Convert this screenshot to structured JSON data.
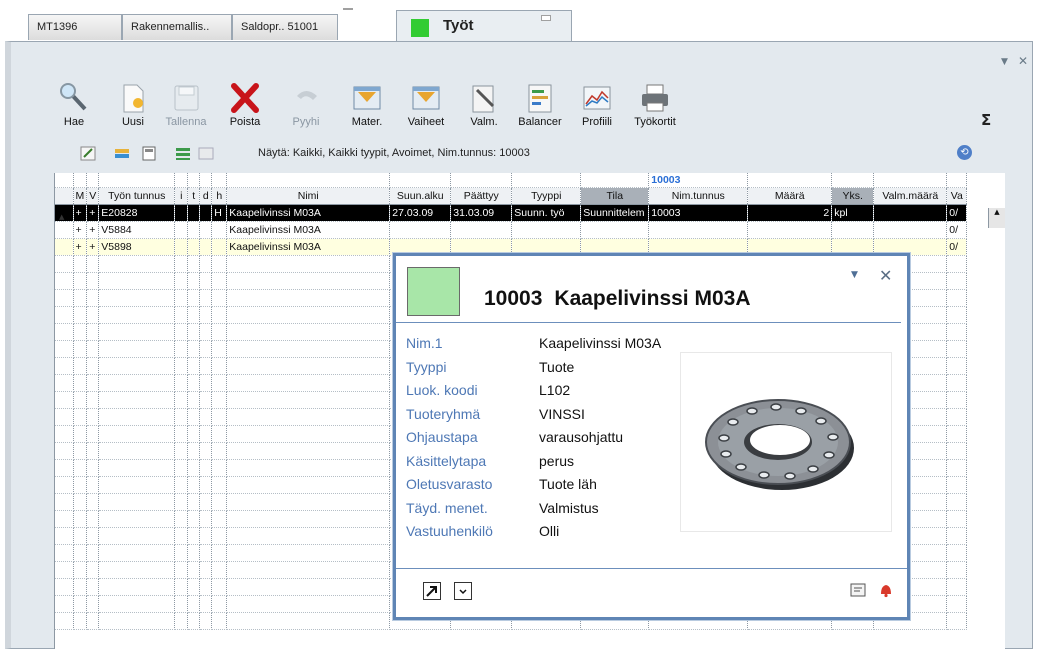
{
  "tabs": [
    {
      "label": "MT1396"
    },
    {
      "label": "Rakennemallis.."
    },
    {
      "label": "Saldopr.. 51001"
    },
    {
      "label": "Työt"
    }
  ],
  "toolbar": {
    "items": [
      {
        "label": "Hae",
        "icon": "search-icon",
        "enabled": true
      },
      {
        "label": "Uusi",
        "icon": "new-document-icon",
        "enabled": true
      },
      {
        "label": "Tallenna",
        "icon": "save-icon",
        "enabled": false
      },
      {
        "label": "Poista",
        "icon": "delete-icon",
        "enabled": true
      },
      {
        "label": "Pyyhi",
        "icon": "undo-icon",
        "enabled": false
      },
      {
        "label": "Mater.",
        "icon": "materials-icon",
        "enabled": true
      },
      {
        "label": "Vaiheet",
        "icon": "phases-icon",
        "enabled": true
      },
      {
        "label": "Valm.",
        "icon": "manufacture-icon",
        "enabled": true
      },
      {
        "label": "Balancer",
        "icon": "balancer-icon",
        "enabled": true
      },
      {
        "label": "Profiili",
        "icon": "profile-chart-icon",
        "enabled": true
      },
      {
        "label": "Työkortit",
        "icon": "printer-icon",
        "enabled": true
      }
    ],
    "sigma": "Σ"
  },
  "subbar": {
    "filter_text": "Näytä: Kaikki, Kaikki tyypit, Avoimet, Nim.tunnus: 10003"
  },
  "grid": {
    "filter_value": "10003",
    "columns": [
      "M",
      "V",
      "Työn tunnus",
      "i",
      "t",
      "d",
      "h",
      "Nimi",
      "Suun.alku",
      "Päättyy",
      "Tyyppi",
      "Tila",
      "Nim.tunnus",
      "Määrä",
      "Yks.",
      "Valm.määrä",
      "Va"
    ],
    "rows": [
      {
        "M": "+",
        "V": "+",
        "tunnus": "E20828",
        "i": "",
        "t": "",
        "d": "",
        "h": "H",
        "nimi": "Kaapelivinssi M03A",
        "alku": "27.03.09",
        "paattyy": "31.03.09",
        "tyyppi": "Suunn. työ",
        "tila": "Suunnittelem",
        "nim": "10003",
        "maara": "2",
        "yks": "kpl",
        "valm": "",
        "va": "0/"
      },
      {
        "M": "+",
        "V": "+",
        "tunnus": "V5884",
        "i": "",
        "t": "",
        "d": "",
        "h": "",
        "nimi": "Kaapelivinssi M03A",
        "alku": "",
        "paattyy": "",
        "tyyppi": "",
        "tila": "",
        "nim": "",
        "maara": "",
        "yks": "",
        "valm": "",
        "va": "0/"
      },
      {
        "M": "+",
        "V": "+",
        "tunnus": "V5898",
        "i": "",
        "t": "",
        "d": "",
        "h": "",
        "nimi": "Kaapelivinssi M03A",
        "alku": "",
        "paattyy": "",
        "tyyppi": "",
        "tila": "",
        "nim": "",
        "maara": "",
        "yks": "",
        "valm": "",
        "va": "0/"
      }
    ]
  },
  "popup": {
    "code": "10003",
    "name": "Kaapelivinssi M03A",
    "swatch_color": "#a8e6a8",
    "properties": [
      {
        "key": "Nim.1",
        "value": "Kaapelivinssi M03A"
      },
      {
        "key": "Tyyppi",
        "value": "Tuote"
      },
      {
        "key": "Luok. koodi",
        "value": "L102"
      },
      {
        "key": "Tuoteryhmä",
        "value": "VINSSI"
      },
      {
        "key": "Ohjaustapa",
        "value": "varausohjattu"
      },
      {
        "key": "Käsittelytapa",
        "value": "perus"
      },
      {
        "key": "Oletusvarasto",
        "value": "Tuote läh"
      },
      {
        "key": "Täyd. menet.",
        "value": "Valmistus"
      },
      {
        "key": "Vastuuhenkilö",
        "value": "Olli"
      }
    ]
  }
}
